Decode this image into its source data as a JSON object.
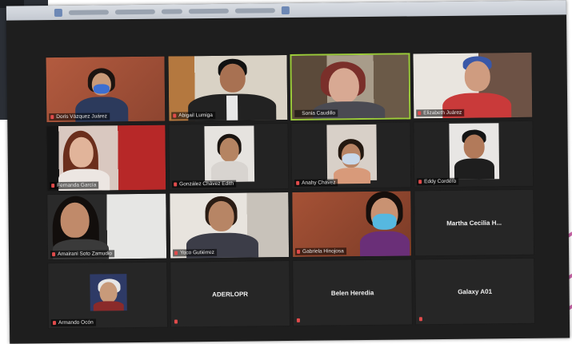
{
  "participants": [
    {
      "name": "Doris Vázquez Juárez",
      "muted": true,
      "video": true
    },
    {
      "name": "Abigail Lumiga",
      "muted": true,
      "video": true
    },
    {
      "name": "Sonia Caudillo",
      "muted": false,
      "video": true,
      "active_speaker": true
    },
    {
      "name": "Elizabeth Juárez",
      "muted": true,
      "video": true
    },
    {
      "name": "Fernanda García",
      "muted": true,
      "video": true
    },
    {
      "name": "González Chávez Edith",
      "muted": true,
      "video": true
    },
    {
      "name": "Anahy Chávez",
      "muted": true,
      "video": true
    },
    {
      "name": "Eddy Cordero",
      "muted": true,
      "video": true
    },
    {
      "name": "Amairani Soto Zamudio",
      "muted": true,
      "video": true
    },
    {
      "name": "Yoco Gutiérrez",
      "muted": true,
      "video": true
    },
    {
      "name": "Gabriela Hinojosa",
      "muted": true,
      "video": true
    },
    {
      "name": "Martha Cecilia H...",
      "muted": false,
      "video": false
    },
    {
      "name": "Armando Ocón",
      "muted": true,
      "video": false,
      "avatar": true
    },
    {
      "name": "ADERLOPR",
      "muted": true,
      "video": false
    },
    {
      "name": "Belen Heredia",
      "muted": true,
      "video": false
    },
    {
      "name": "Galaxy A01",
      "muted": true,
      "video": false
    }
  ],
  "colors": {
    "window_bg": "#1e1e1e",
    "active_border": "#9ccb3a",
    "muted_icon": "#e14b4b",
    "accent_stripe": "#c24a9a"
  }
}
